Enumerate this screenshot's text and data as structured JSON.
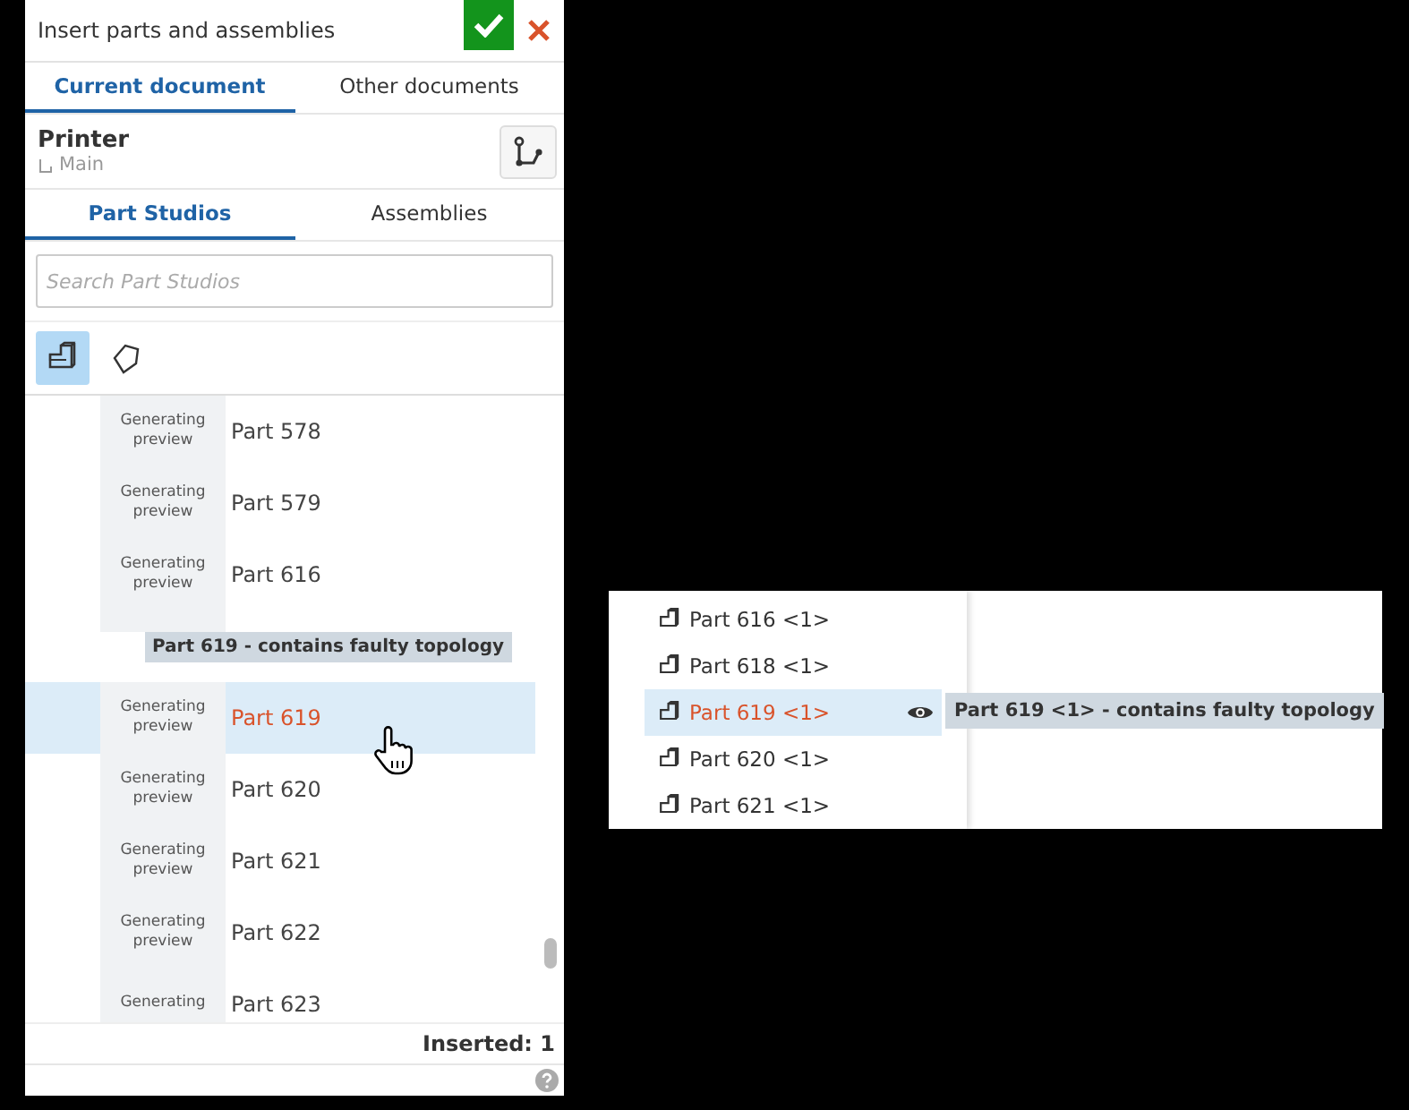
{
  "panel": {
    "title": "Insert parts and assemblies",
    "doc_tabs": [
      {
        "label": "Current document",
        "selected": true
      },
      {
        "label": "Other documents",
        "selected": false
      }
    ],
    "document": {
      "name": "Printer",
      "branch": "Main"
    },
    "type_tabs": [
      {
        "label": "Part Studios",
        "selected": true
      },
      {
        "label": "Assemblies",
        "selected": false
      }
    ],
    "search": {
      "placeholder": "Search Part Studios"
    },
    "filters": [
      {
        "kind": "solid",
        "selected": true
      },
      {
        "kind": "surface",
        "selected": false
      }
    ],
    "parts": [
      {
        "thumb": "Generating preview",
        "name": "Part 578",
        "selected": false
      },
      {
        "thumb": "Generating preview",
        "name": "Part 579",
        "selected": false
      },
      {
        "thumb": "Generating preview",
        "name": "Part 616",
        "selected": false
      },
      {
        "kind": "covered",
        "selected": false
      },
      {
        "thumb": "Generating preview",
        "name": "Part 619",
        "selected": true
      },
      {
        "thumb": "Generating preview",
        "name": "Part 620",
        "selected": false
      },
      {
        "thumb": "Generating preview",
        "name": "Part 621",
        "selected": false
      },
      {
        "thumb": "Generating preview",
        "name": "Part 622",
        "selected": false
      },
      {
        "thumb": "Generating",
        "name": "Part 623",
        "selected": false
      }
    ],
    "tooltip": "Part 619 - contains faulty topology",
    "inserted": "Inserted: 1"
  },
  "inset": {
    "parts": [
      {
        "name": "Part 616 <1>",
        "selected": false
      },
      {
        "name": "Part 618 <1>",
        "selected": false
      },
      {
        "name": "Part 619 <1>",
        "selected": true
      },
      {
        "name": "Part 620 <1>",
        "selected": false
      },
      {
        "name": "Part 621 <1>",
        "selected": false
      }
    ],
    "tooltip": "Part 619 <1> - contains faulty topology"
  }
}
